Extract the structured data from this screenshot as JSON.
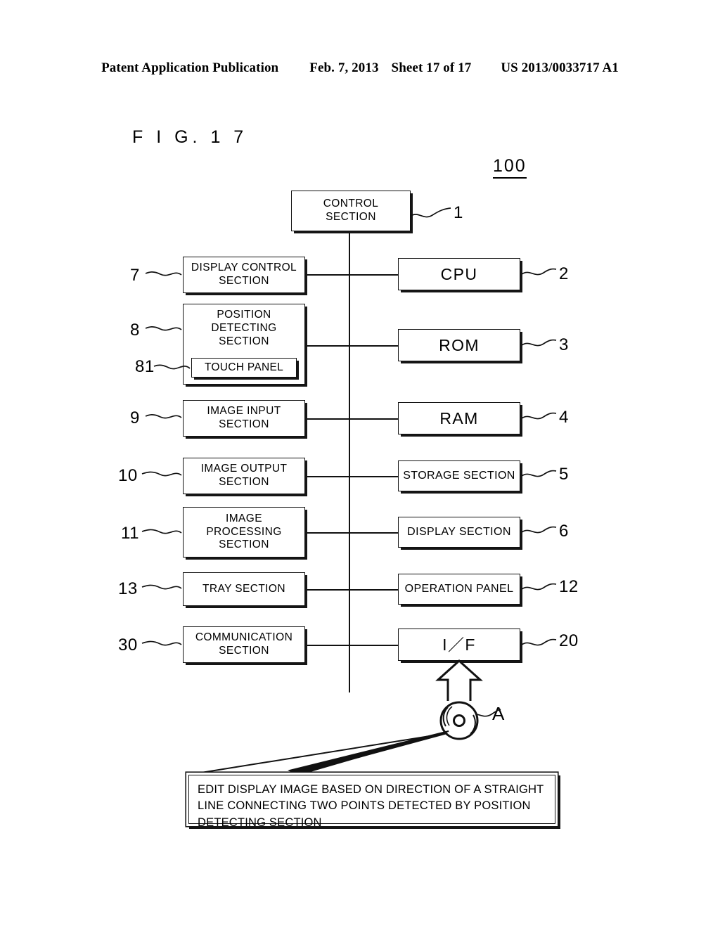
{
  "header": {
    "publication": "Patent Application Publication",
    "date": "Feb. 7, 2013",
    "sheet": "Sheet 17 of 17",
    "patent_number": "US 2013/0033717 A1"
  },
  "figure": {
    "label": "F I G.  1 7",
    "assembly_number": "100"
  },
  "blocks": {
    "control_section": {
      "label": "CONTROL\nSECTION",
      "ref": "1"
    },
    "left": [
      {
        "label": "DISPLAY CONTROL\nSECTION",
        "ref": "7"
      },
      {
        "label": "POSITION\nDETECTING\nSECTION",
        "ref": "8"
      },
      {
        "label": "IMAGE INPUT\nSECTION",
        "ref": "9"
      },
      {
        "label": "IMAGE OUTPUT\nSECTION",
        "ref": "10"
      },
      {
        "label": "IMAGE\nPROCESSING\nSECTION",
        "ref": "11"
      },
      {
        "label": "TRAY SECTION",
        "ref": "13"
      },
      {
        "label": "COMMUNICATION\nSECTION",
        "ref": "30"
      }
    ],
    "touch_panel": {
      "label": "TOUCH PANEL",
      "ref": "81"
    },
    "right": [
      {
        "label": "CPU",
        "ref": "2"
      },
      {
        "label": "ROM",
        "ref": "3"
      },
      {
        "label": "RAM",
        "ref": "4"
      },
      {
        "label": "STORAGE SECTION",
        "ref": "5"
      },
      {
        "label": "DISPLAY SECTION",
        "ref": "6"
      },
      {
        "label": "OPERATION PANEL",
        "ref": "12"
      },
      {
        "label": "I／F",
        "ref": "20"
      }
    ]
  },
  "media": {
    "ref": "A"
  },
  "callout": {
    "text": "EDIT DISPLAY IMAGE BASED ON DIRECTION OF A STRAIGHT LINE CONNECTING TWO POINTS DETECTED BY POSITION DETECTING SECTION"
  },
  "colors": {
    "ink": "#111111",
    "paper": "#ffffff"
  }
}
